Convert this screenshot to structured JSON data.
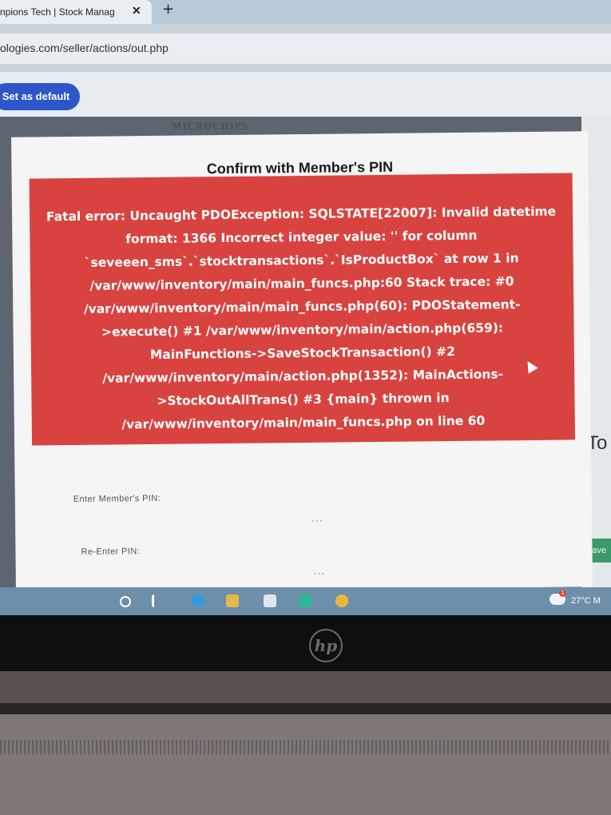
{
  "browser": {
    "tab_title": "npions Tech | Stock Manag",
    "tab_close": "✕",
    "new_tab": "+",
    "url": "ologies.com/seller/actions/out.php",
    "set_default_label": "Set as default"
  },
  "page": {
    "side_label": "MICROCHIPS",
    "to_label": "To",
    "save_label": "Save"
  },
  "modal": {
    "title": "Confirm with Member's PIN",
    "error_lines": [
      "Fatal error: Uncaught PDOException: SQLSTATE[22007]: Invalid datetime",
      "format: 1366 Incorrect integer value: '' for column",
      "`seveeen_sms`.`stocktransactions`.`IsProductBox` at row 1 in",
      "/var/www/inventory/main/main_funcs.php:60 Stack trace: #0",
      "/var/www/inventory/main/main_funcs.php(60): PDOStatement-",
      ">execute() #1 /var/www/inventory/main/action.php(659):",
      "MainFunctions->SaveStockTransaction() #2",
      "/var/www/inventory/main/action.php(1352): MainActions-",
      ">StockOutAllTrans() #3 {main} thrown in",
      "/var/www/inventory/main/main_funcs.php on line 60"
    ],
    "pin_label": "Enter Member's PIN:",
    "pin_placeholder": "...",
    "repin_label": "Re-Enter PIN:",
    "repin_placeholder": "..."
  },
  "taskbar": {
    "weather_badge": "1",
    "temperature": "27°C  M"
  },
  "laptop": {
    "logo": "hp"
  },
  "colors": {
    "error_background": "#d9433f",
    "default_button": "#2d56c9",
    "save_button": "#3b9a6a"
  }
}
